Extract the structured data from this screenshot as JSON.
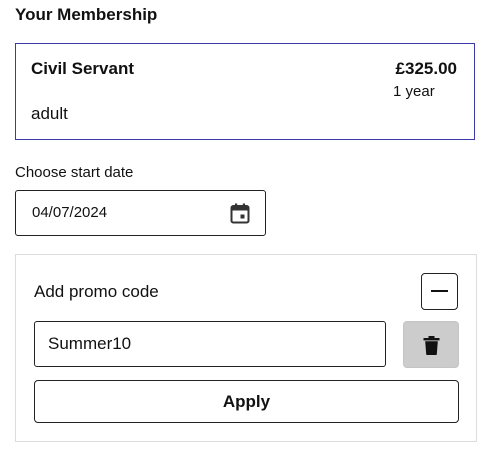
{
  "membership": {
    "section_title": "Your Membership",
    "plan_name": "Civil Servant",
    "price": "£325.00",
    "term": "1 year",
    "type": "adult",
    "border_color": "#3a3aa8"
  },
  "start_date": {
    "label": "Choose start date",
    "value": "04/07/2024",
    "icon": "calendar-icon"
  },
  "promo": {
    "label": "Add promo code",
    "toggle_icon": "minus-icon",
    "input_value": "Summer10",
    "delete_icon": "trash-icon",
    "apply_label": "Apply"
  }
}
